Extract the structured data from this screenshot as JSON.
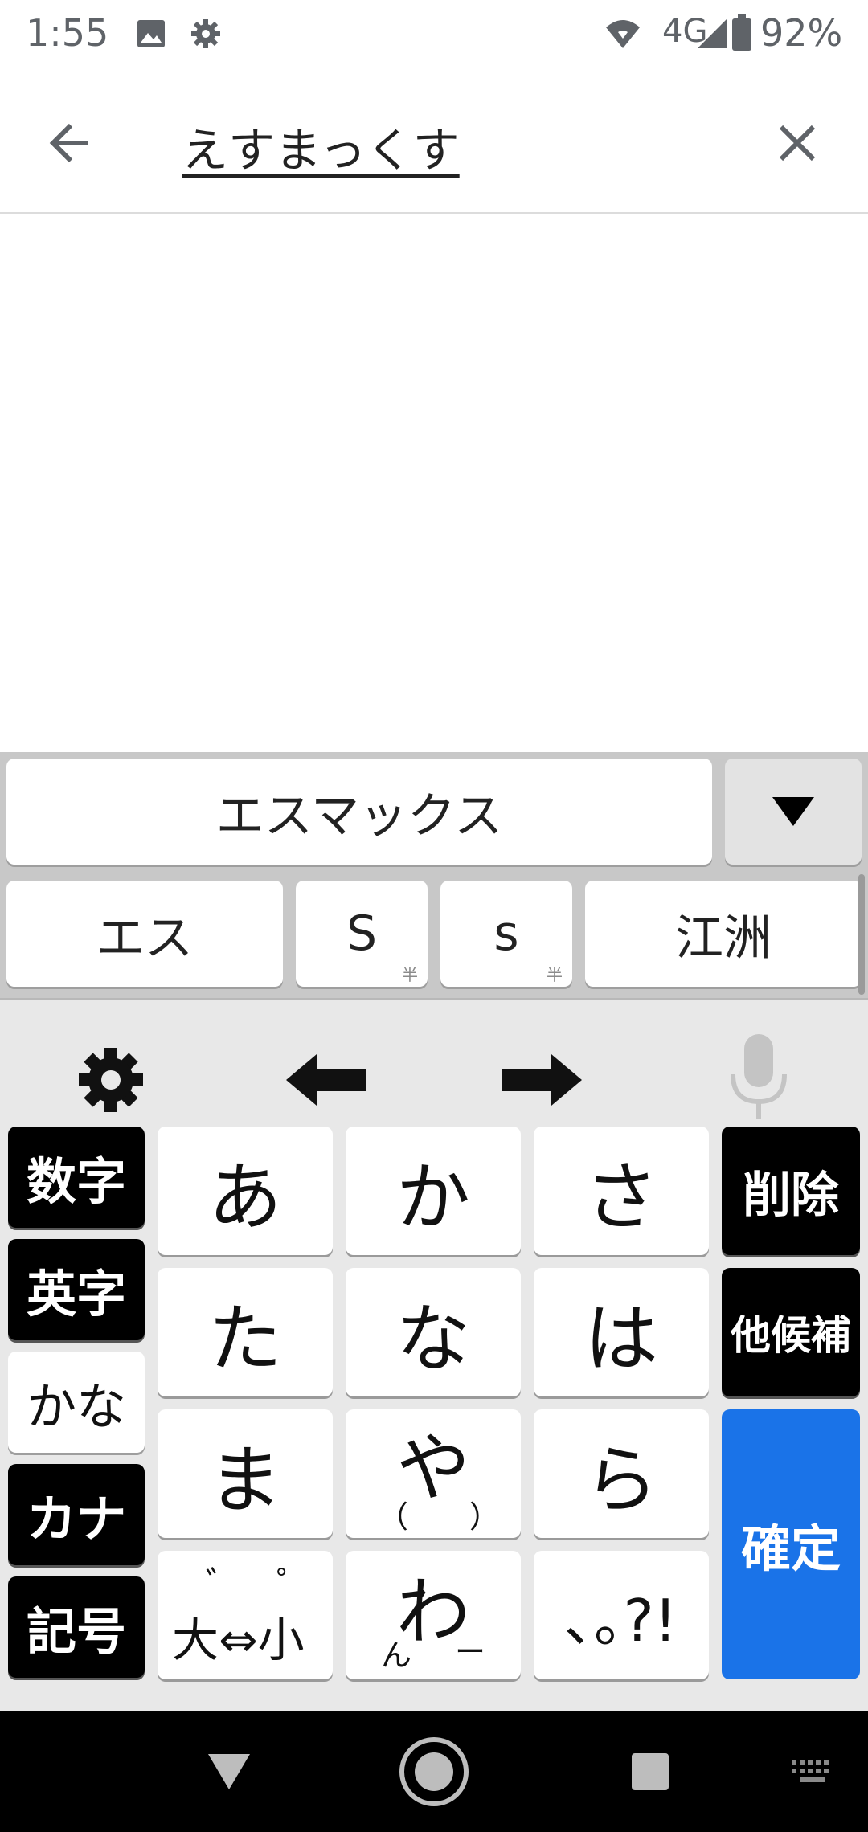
{
  "status_bar": {
    "time": "1:55",
    "network": "4G",
    "battery_percent": "92%",
    "icons": [
      "image-icon",
      "gear-icon",
      "wifi-icon",
      "signal-icon",
      "battery-icon"
    ]
  },
  "search": {
    "query": "えすまっくす"
  },
  "candidates": {
    "primary": "エスマックス",
    "secondary": [
      {
        "label": "エス",
        "half": ""
      },
      {
        "label": "S",
        "half": "半"
      },
      {
        "label": "s",
        "half": "半"
      },
      {
        "label": "江洲",
        "half": ""
      }
    ]
  },
  "keyboard": {
    "tools": [
      "gear-icon",
      "arrow-left-icon",
      "arrow-right-icon",
      "microphone-icon"
    ],
    "modes": [
      "数字",
      "英字",
      "かな",
      "カナ",
      "記号"
    ],
    "active_mode": "かな",
    "keys": {
      "a": "あ",
      "ka": "か",
      "sa": "さ",
      "ta": "た",
      "na": "な",
      "ha": "は",
      "ma": "ま",
      "ya": "や",
      "ya_sub": "（　　）",
      "ra": "ら",
      "dakuten_top": "゛　゜",
      "dakuten_main": "大⇔小",
      "wa": "わ",
      "wa_sub_left": "ん",
      "wa_sub_right": "ー",
      "punct": "､｡?!"
    },
    "delete": "削除",
    "other_candidates": "他候補",
    "confirm": "確定"
  },
  "colors": {
    "accent": "#1a73e8",
    "key_dark": "#000000",
    "keyboard_bg": "#e8e8e8"
  }
}
